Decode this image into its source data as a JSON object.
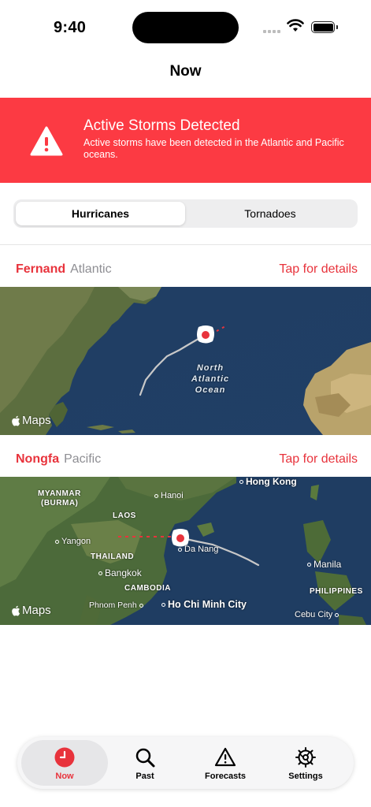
{
  "status_bar": {
    "time": "9:40"
  },
  "nav": {
    "title": "Now"
  },
  "alert": {
    "title": "Active Storms Detected",
    "body": "Active storms have been detected in the Atlantic and Pacific oceans."
  },
  "segmented": {
    "options": [
      "Hurricanes",
      "Tornadoes"
    ],
    "selected": "Hurricanes"
  },
  "storms": [
    {
      "name": "Fernand",
      "basin": "Atlantic",
      "link": "Tap for details",
      "map": {
        "labels": {
          "ocean_line1": "North",
          "ocean_line2": "Atlantic",
          "ocean_line3": "Ocean"
        }
      }
    },
    {
      "name": "Nongfa",
      "basin": "Pacific",
      "link": "Tap for details",
      "map": {
        "labels": {
          "myanmar": "MYANMAR",
          "burma": "(BURMA)",
          "laos": "LAOS",
          "thailand": "THAILAND",
          "cambodia": "CAMBODIA",
          "philippines": "PHILIPPINES",
          "hong_kong": "Hong Kong",
          "hanoi": "Hanoi",
          "yangon": "Yangon",
          "da_nang": "Da Nang",
          "bangkok": "Bangkok",
          "phnom_penh": "Phnom Penh",
          "ho_chi_minh": "Ho Chi Minh City",
          "manila": "Manila",
          "cebu": "Cebu City"
        }
      }
    }
  ],
  "maps_attribution": "Maps",
  "tabs": [
    {
      "label": "Now",
      "icon": "clock-icon",
      "active": true
    },
    {
      "label": "Past",
      "icon": "magnifying-glass-icon",
      "active": false
    },
    {
      "label": "Forecasts",
      "icon": "warning-triangle-icon",
      "active": false
    },
    {
      "label": "Settings",
      "icon": "gear-icon",
      "active": false
    }
  ],
  "colors": {
    "accent": "#e8333c",
    "banner": "#fc3a43"
  }
}
